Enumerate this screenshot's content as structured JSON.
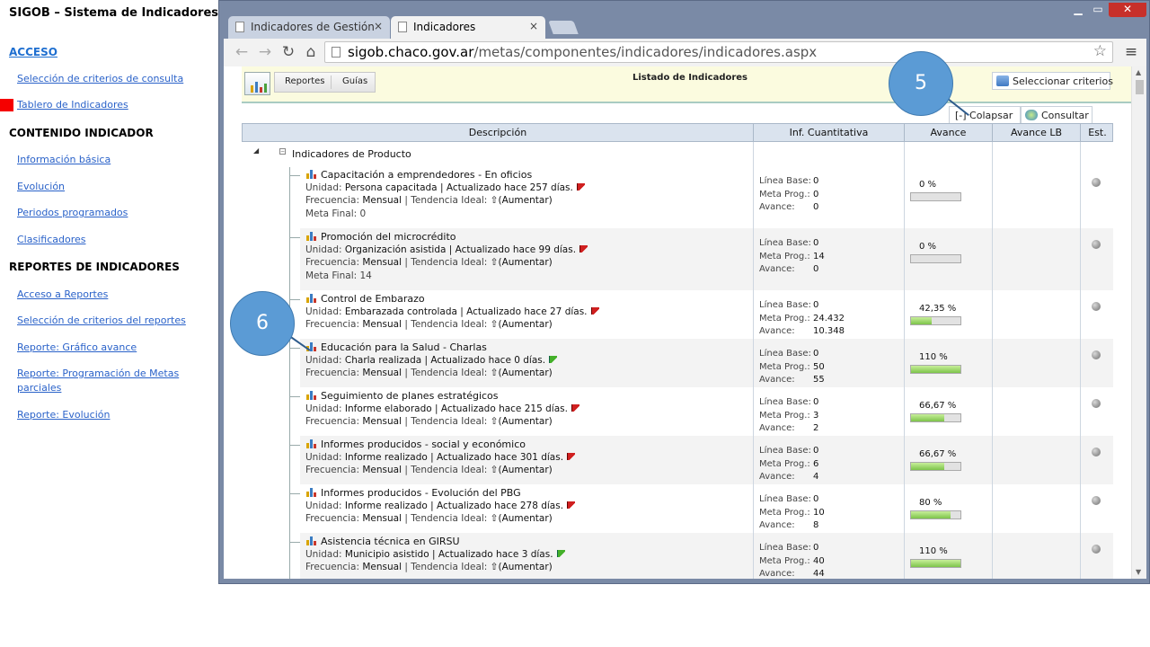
{
  "slide": {
    "title": "SIGOB – Sistema de Indicadores",
    "sections": [
      {
        "heading": "ACCESO",
        "links": [
          "Selección de criterios de consulta",
          "Tablero de Indicadores"
        ]
      },
      {
        "heading": "CONTENIDO INDICADOR",
        "links": [
          "Información básica",
          "Evolución",
          "Periodos programados",
          "Clasificadores"
        ]
      },
      {
        "heading": "REPORTES DE INDICADORES",
        "links": [
          "Acceso a Reportes",
          "Selección de criterios del reportes",
          "Reporte: Gráfico avance",
          "Reporte: Programación de Metas parciales",
          "Reporte: Evolución"
        ]
      }
    ],
    "active_link": "Tablero de Indicadores",
    "marker_color": "#f50000"
  },
  "browser": {
    "tabs": [
      {
        "label": "Indicadores de Gestión",
        "close": "×"
      },
      {
        "label": "Indicadores",
        "close": "×"
      }
    ],
    "controls": {
      "minimize": "▁",
      "maximize": "▭",
      "close": "✕"
    },
    "url_host": "sigob.chaco.gov.ar",
    "url_path": "/metas/componentes/indicadores/indicadores.aspx",
    "icons": {
      "back": "back-arrow-icon",
      "forward": "forward-arrow-icon",
      "reload": "reload-icon",
      "home": "home-icon",
      "bookmark": "star-icon",
      "menu": "hamburger-menu-icon"
    }
  },
  "app": {
    "tabs": [
      "Reportes",
      "Guías"
    ],
    "title": "Listado de Indicadores",
    "buttons": {
      "seleccionar": "Seleccionar criterios",
      "colapsar": "[-] Colapsar",
      "consultar": "Consultar"
    },
    "columns": [
      "Descripción",
      "Inf. Cuantitativa",
      "Avance",
      "Avance LB",
      "Est."
    ],
    "group": {
      "label": "Indicadores de Producto",
      "toggle": "◢",
      "box": "−"
    },
    "labels": {
      "unidad": "Unidad:",
      "actualizado": "| Actualizado hace",
      "frecuencia": "Frecuencia:",
      "tendencia": "| Tendencia Ideal:",
      "meta_final": "Meta Final:",
      "linea_base": "Línea Base:",
      "meta_prog": "Meta Prog.:",
      "avance": "Avance:"
    },
    "indicators": [
      {
        "title": "Capacitación a emprendedores - En oficios",
        "unidad": "Persona capacitada",
        "dias": "257 días.",
        "flag": "red",
        "frecuencia": "Mensual",
        "tendencia": "⇧(Aumentar)",
        "meta_final": "0",
        "linea_base": "0",
        "meta_prog": "0",
        "avance": "0",
        "pct_label": "0 %",
        "pct": 0
      },
      {
        "title": "Promoción del microcrédito",
        "unidad": "Organización asistida",
        "dias": "99 días.",
        "flag": "red",
        "frecuencia": "Mensual",
        "tendencia": "⇧(Aumentar)",
        "meta_final": "14",
        "linea_base": "0",
        "meta_prog": "14",
        "avance": "0",
        "pct_label": "0 %",
        "pct": 0
      },
      {
        "title": "Control de Embarazo",
        "unidad": "Embarazada controlada",
        "dias": "27 días.",
        "flag": "red",
        "frecuencia": "Mensual",
        "tendencia": "⇧(Aumentar)",
        "meta_final": "",
        "linea_base": "0",
        "meta_prog": "24.432",
        "avance": "10.348",
        "pct_label": "42,35 %",
        "pct": 42.35
      },
      {
        "title": "Educación para la Salud - Charlas",
        "unidad": "Charla realizada",
        "dias": "0 días.",
        "flag": "green",
        "frecuencia": "Mensual",
        "tendencia": "⇧(Aumentar)",
        "meta_final": "",
        "linea_base": "0",
        "meta_prog": "50",
        "avance": "55",
        "pct_label": "110 %",
        "pct": 110
      },
      {
        "title": "Seguimiento de planes estratégicos",
        "unidad": "Informe elaborado",
        "dias": "215 días.",
        "flag": "red",
        "frecuencia": "Mensual",
        "tendencia": "⇧(Aumentar)",
        "meta_final": "",
        "linea_base": "0",
        "meta_prog": "3",
        "avance": "2",
        "pct_label": "66,67 %",
        "pct": 66.67
      },
      {
        "title": "Informes producidos - social y económico",
        "unidad": "Informe realizado",
        "dias": "301 días.",
        "flag": "red",
        "frecuencia": "Mensual",
        "tendencia": "⇧(Aumentar)",
        "meta_final": "",
        "linea_base": "0",
        "meta_prog": "6",
        "avance": "4",
        "pct_label": "66,67 %",
        "pct": 66.67
      },
      {
        "title": "Informes producidos - Evolución del PBG",
        "unidad": "Informe realizado",
        "dias": "278 días.",
        "flag": "red",
        "frecuencia": "Mensual",
        "tendencia": "⇧(Aumentar)",
        "meta_final": "",
        "linea_base": "0",
        "meta_prog": "10",
        "avance": "8",
        "pct_label": "80 %",
        "pct": 80
      },
      {
        "title": "Asistencia técnica en GIRSU",
        "unidad": "Municipio asistido",
        "dias": "3 días.",
        "flag": "green",
        "frecuencia": "Mensual",
        "tendencia": "⇧(Aumentar)",
        "meta_final": "",
        "linea_base": "0",
        "meta_prog": "40",
        "avance": "44",
        "pct_label": "110 %",
        "pct": 110
      }
    ]
  },
  "callouts": [
    "5",
    "6"
  ],
  "colors": {
    "callout": "#5b9bd5",
    "header_bg": "#fbfbdf",
    "table_head": "#dae3ee",
    "progress": "#7dc44a"
  }
}
